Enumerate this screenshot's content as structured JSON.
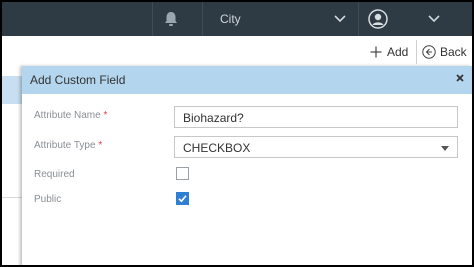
{
  "header": {
    "city_label": "City"
  },
  "toolbar": {
    "add_label": "Add",
    "back_label": "Back"
  },
  "modal": {
    "title": "Add Custom Field",
    "fields": {
      "attribute_name": {
        "label": "Attribute Name",
        "required_mark": "*",
        "value": "Biohazard?"
      },
      "attribute_type": {
        "label": "Attribute Type",
        "required_mark": "*",
        "value": "CHECKBOX"
      },
      "required": {
        "label": "Required",
        "checked": false
      },
      "public": {
        "label": "Public",
        "checked": true
      }
    }
  },
  "colors": {
    "topbar": "#2f3b44",
    "modal_header": "#b3d5ee",
    "checkbox_checked": "#2f7fd3",
    "required_star": "#e04040"
  },
  "icons": [
    "bell-icon",
    "chevron-down-icon",
    "user-icon",
    "plus-icon",
    "back-arrow-icon",
    "close-icon",
    "dropdown-caret-icon",
    "checkmark-icon"
  ]
}
